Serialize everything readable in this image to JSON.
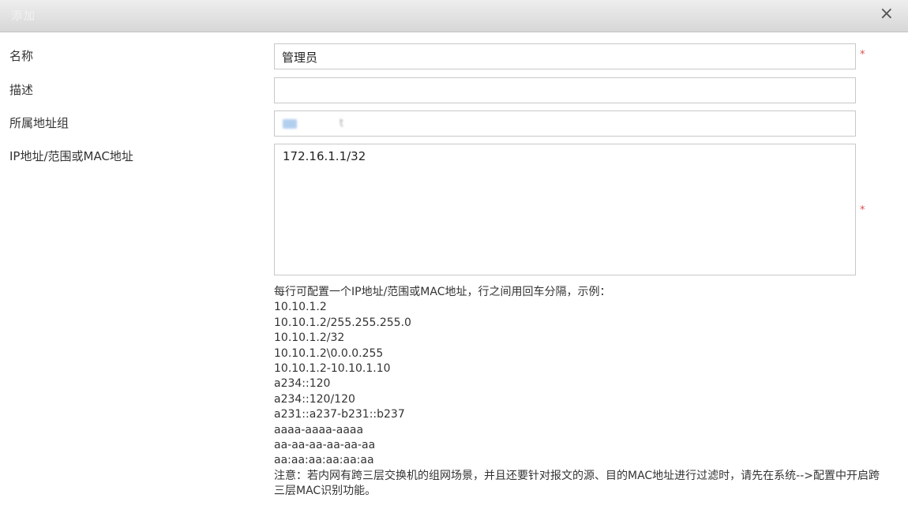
{
  "dialog": {
    "title": "添加",
    "close_label": "×"
  },
  "form": {
    "name_label": "名称",
    "name_value": "管理员",
    "desc_label": "描述",
    "desc_value": "",
    "group_label": "所属地址组",
    "group_value": "t",
    "address_label": "IP地址/范围或MAC地址",
    "address_value": "172.16.1.1/32",
    "required_mark": "*"
  },
  "help": {
    "intro": "每行可配置一个IP地址/范围或MAC地址，行之间用回车分隔，示例：",
    "examples": [
      "10.10.1.2",
      "10.10.1.2/255.255.255.0",
      "10.10.1.2/32",
      "10.10.1.2\\0.0.0.255",
      "10.10.1.2-10.10.1.10",
      "a234::120",
      "a234::120/120",
      "a231::a237-b231::b237",
      "aaaa-aaaa-aaaa",
      "aa-aa-aa-aa-aa-aa",
      "aa:aa:aa:aa:aa:aa"
    ],
    "note": "注意：若内网有跨三层交换机的组网场景，并且还要针对报文的源、目的MAC地址进行过滤时，请先在系统-->配置中开启跨三层MAC识别功能。"
  }
}
